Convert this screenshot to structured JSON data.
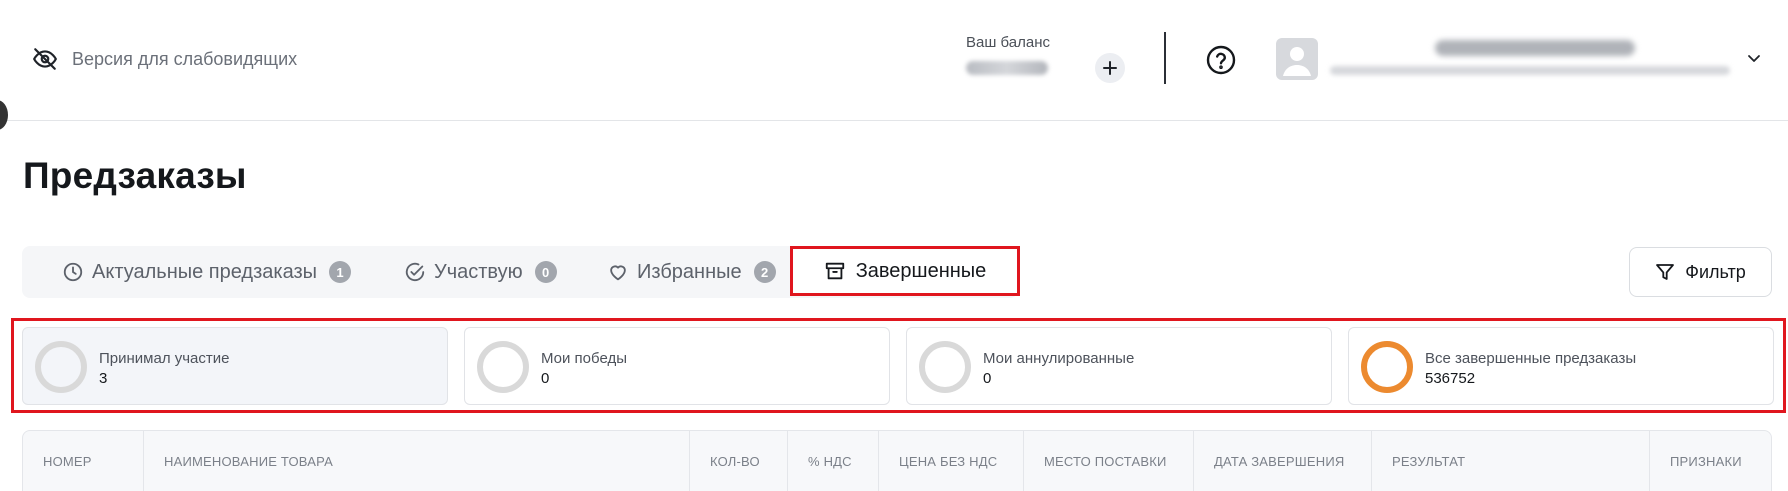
{
  "header": {
    "accessibility_label": "Версия для слабовидящих",
    "balance_label": "Ваш баланс"
  },
  "page": {
    "title": "Предзаказы"
  },
  "tabs": [
    {
      "label": "Актуальные предзаказы",
      "count": "1",
      "icon": "clock-icon"
    },
    {
      "label": "Участвую",
      "count": "0",
      "icon": "check-circle-icon"
    },
    {
      "label": "Избранные",
      "count": "2",
      "icon": "heart-icon"
    },
    {
      "label": "Завершенные",
      "icon": "archive-icon",
      "active": true
    }
  ],
  "filter": {
    "label": "Фильтр"
  },
  "stats": [
    {
      "label": "Принимал участие",
      "value": "3",
      "ring_color": "#d9d9d9",
      "selected": true
    },
    {
      "label": "Мои победы",
      "value": "0",
      "ring_color": "#d9d9d9"
    },
    {
      "label": "Мои аннулированные",
      "value": "0",
      "ring_color": "#d9d9d9"
    },
    {
      "label": "Все завершенные предзаказы",
      "value": "536752",
      "ring_color": "#ec8a2f"
    }
  ],
  "table": {
    "columns": [
      "НОМЕР",
      "НАИМЕНОВАНИЕ ТОВАРА",
      "КОЛ-ВО",
      "% НДС",
      "ЦЕНА БЕЗ НДС",
      "МЕСТО ПОСТАВКИ",
      "ДАТА ЗАВЕРШЕНИЯ",
      "РЕЗУЛЬТАТ",
      "ПРИЗНАКИ"
    ]
  },
  "colors": {
    "highlight": "#e0161e",
    "accent_ring": "#ec8a2f"
  }
}
